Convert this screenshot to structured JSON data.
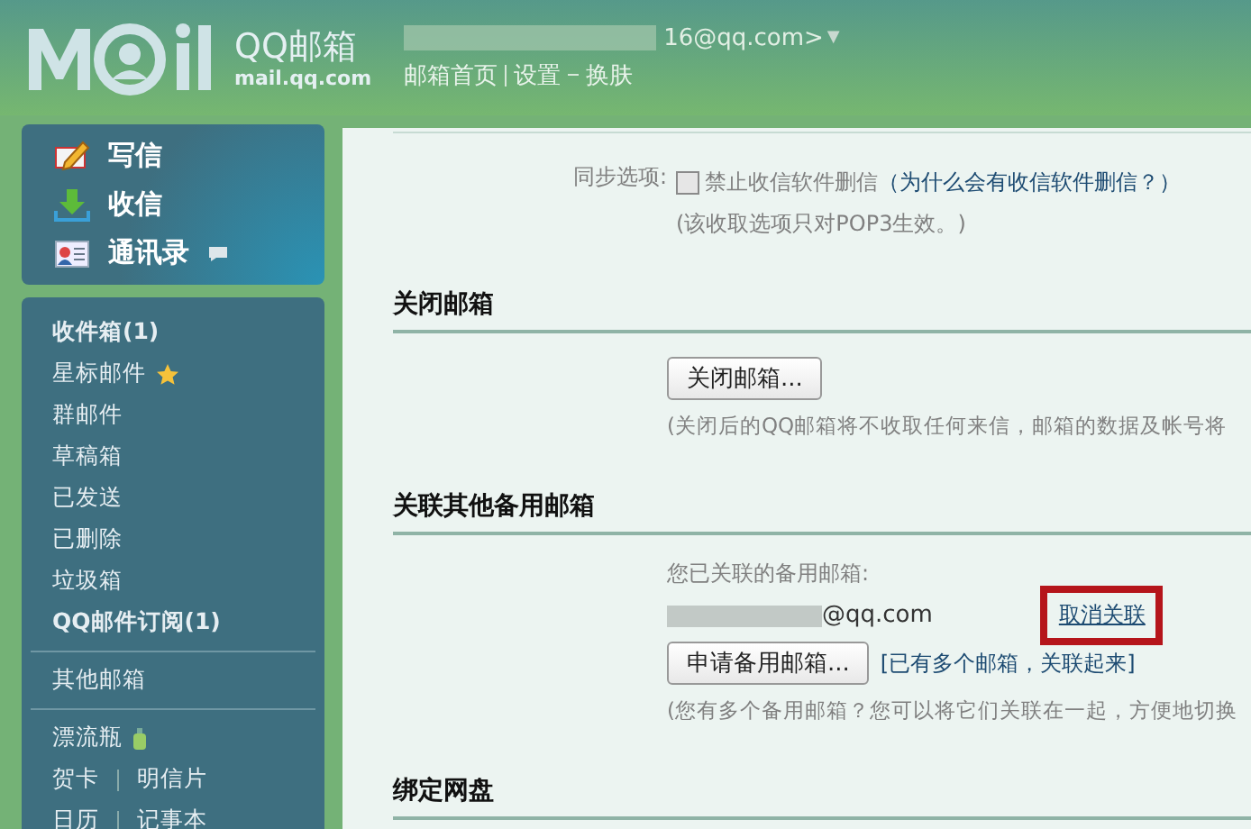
{
  "header": {
    "logo_text": "QQ邮箱",
    "logo_domain": "mail.qq.com",
    "account": "16@qq.com>",
    "account_caret": "▼",
    "links": [
      "邮箱首页",
      "设置",
      "换肤"
    ]
  },
  "sidebar": {
    "actions": [
      {
        "kind": "compose",
        "label": "写信"
      },
      {
        "kind": "receive",
        "label": "收信"
      },
      {
        "kind": "contacts",
        "label": "通讯录"
      }
    ],
    "groups": [
      [
        {
          "label": "收件箱(1)",
          "unread": true
        },
        {
          "label": "星标邮件",
          "kind": "star",
          "unread": false
        },
        {
          "label": "群邮件",
          "unread": false
        },
        {
          "label": "草稿箱",
          "unread": false
        },
        {
          "label": "已发送",
          "unread": false
        },
        {
          "label": "已删除",
          "unread": false
        },
        {
          "label": "垃圾箱",
          "unread": false
        },
        {
          "label": "QQ邮件订阅(1)",
          "unread": true
        }
      ],
      [
        {
          "label": "其他邮箱",
          "unread": false
        }
      ],
      [
        {
          "label": "漂流瓶",
          "kind": "bottle",
          "unread": false
        },
        {
          "labels": [
            "贺卡",
            "明信片"
          ]
        },
        {
          "labels": [
            "日历",
            "记事本"
          ]
        }
      ]
    ]
  },
  "content": {
    "sync": {
      "label": "同步选项:",
      "checkbox": {
        "label": "禁止收信软件删信",
        "checked": false
      },
      "help_link": "（为什么会有收信软件删信？）",
      "note": "(该收取选项只对POP3生效。)"
    },
    "sections": [
      {
        "title": "关闭邮箱",
        "button": "关闭邮箱...",
        "note": "(关闭后的QQ邮箱将不收取任何来信，邮箱的数据及帐号将"
      },
      {
        "title": "关联其他备用邮箱",
        "linked_label": "您已关联的备用邮箱:",
        "linked_email": "@qq.com",
        "unlink": "取消关联",
        "button": "申请备用邮箱...",
        "link": "[已有多个邮箱，关联起来]",
        "note": "(您有多个备用邮箱？您可以将它们关联在一起，方便地切换"
      },
      {
        "title": "绑定网盘"
      }
    ]
  }
}
